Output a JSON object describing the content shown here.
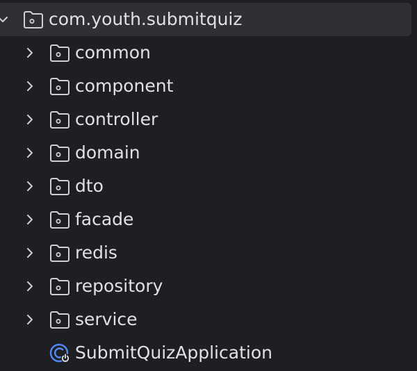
{
  "project_tree": {
    "root": {
      "label": "com.youth.submitquiz",
      "icon": "package-folder-icon",
      "expanded": true
    },
    "children": [
      {
        "label": "common",
        "icon": "package-folder-icon",
        "type": "folder"
      },
      {
        "label": "component",
        "icon": "package-folder-icon",
        "type": "folder"
      },
      {
        "label": "controller",
        "icon": "package-folder-icon",
        "type": "folder"
      },
      {
        "label": "domain",
        "icon": "package-folder-icon",
        "type": "folder"
      },
      {
        "label": "dto",
        "icon": "package-folder-icon",
        "type": "folder"
      },
      {
        "label": "facade",
        "icon": "package-folder-icon",
        "type": "folder"
      },
      {
        "label": "redis",
        "icon": "package-folder-icon",
        "type": "folder"
      },
      {
        "label": "repository",
        "icon": "package-folder-icon",
        "type": "folder"
      },
      {
        "label": "service",
        "icon": "package-folder-icon",
        "type": "folder"
      },
      {
        "label": "SubmitQuizApplication",
        "icon": "spring-boot-class-icon",
        "type": "class"
      }
    ]
  },
  "colors": {
    "background": "#1e1f22",
    "selected_row": "#2e3034",
    "text": "#dfe1e5",
    "icon_stroke": "#ced0d6",
    "class_icon": "#548af7"
  }
}
